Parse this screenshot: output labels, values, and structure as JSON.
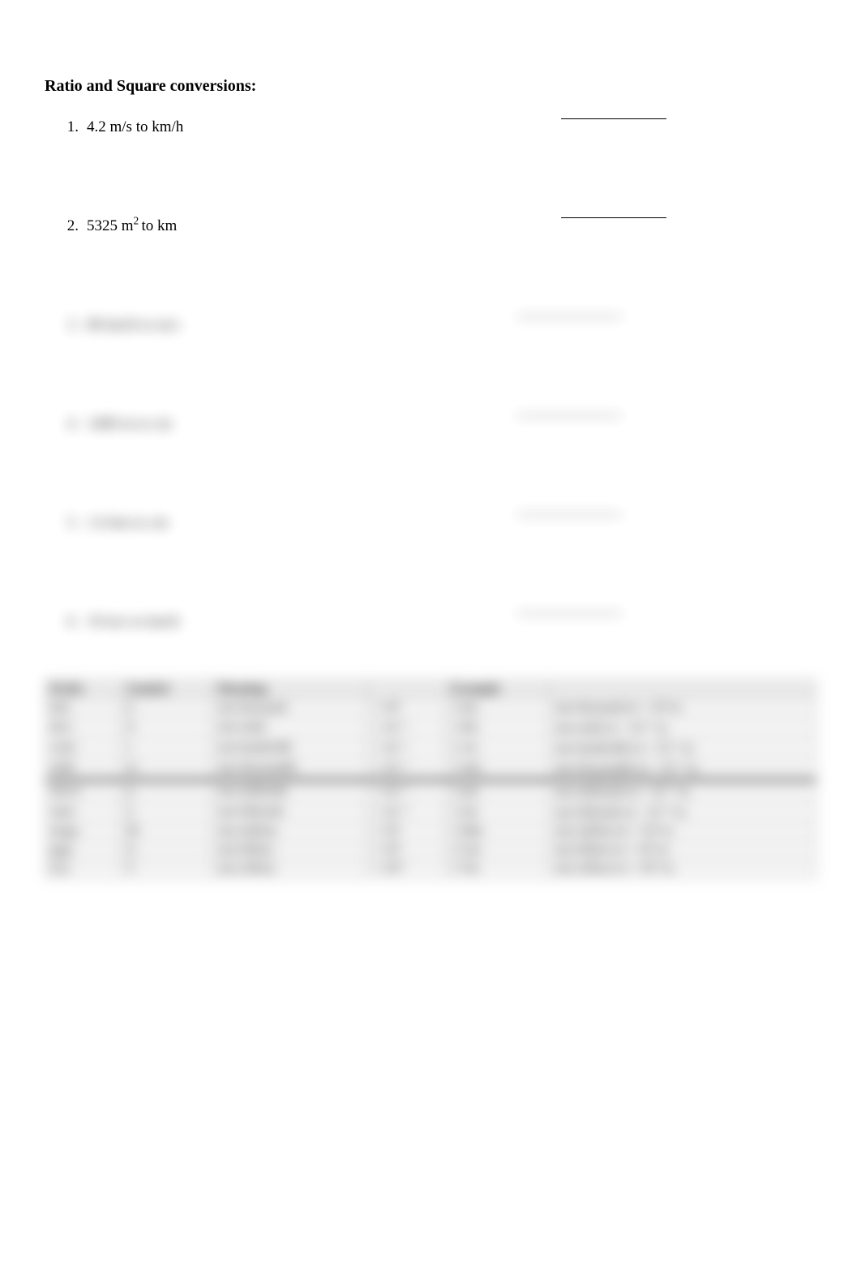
{
  "heading": "Ratio and Square conversions:",
  "questions": [
    {
      "num": "1.",
      "text_pre": "4.2 m/s to km/h",
      "sup": "",
      "text_post": "",
      "blurred": false
    },
    {
      "num": "2.",
      "text_pre": "5325 m",
      "sup": "2 ",
      "text_post": "to km",
      "blurred": false
    },
    {
      "num": "3.",
      "text_pre": "80 km/h to m/s",
      "sup": "",
      "text_post": "",
      "blurred": true
    },
    {
      "num": "4.",
      "text_pre": "1400 m to cm",
      "sup": "",
      "text_post": "",
      "blurred": true
    },
    {
      "num": "5.",
      "text_pre": "1.6 km to cm",
      "sup": "",
      "text_post": "",
      "blurred": true
    },
    {
      "num": "6.",
      "text_pre": "19 m/s to km/h",
      "sup": "",
      "text_post": "",
      "blurred": true
    }
  ],
  "table": {
    "headers": [
      "Prefix",
      "Symbol",
      "Meaning",
      "",
      "Example",
      ""
    ],
    "rows_top": [
      [
        "kilo",
        "k",
        "one thousand",
        "× 10³",
        "1 km",
        "one thousand m = 10³ m"
      ],
      [
        "deci",
        "d",
        "one tenth",
        "× 10⁻¹",
        "1 dm",
        "one tenth m = 10⁻¹ m"
      ],
      [
        "centi",
        "c",
        "one hundredth",
        "× 10⁻²",
        "1 cm",
        "one hundredth m = 10⁻² m"
      ],
      [
        "milli",
        "m",
        "one thousandth",
        "× 10⁻³",
        "1 mm",
        "one thousandth m = 10⁻³ m"
      ]
    ],
    "rows_bottom": [
      [
        "micro",
        "μ",
        "one millionth",
        "× 10⁻⁶",
        "1 μm",
        "one millionth m = 10⁻⁶ m"
      ],
      [
        "nano",
        "n",
        "one billionth",
        "× 10⁻⁹",
        "1 nm",
        "one billionth m = 10⁻⁹ m"
      ],
      [
        "mega",
        "M",
        "one million",
        "× 10⁶",
        "1 Mm",
        "one million m = 10⁶ m"
      ],
      [
        "giga",
        "G",
        "one billion",
        "× 10⁹",
        "1 Gm",
        "one billion m = 10⁹ m"
      ],
      [
        "tera",
        "T",
        "one trillion",
        "× 10¹²",
        "1 Tm",
        "one trillion m = 10¹² m"
      ]
    ]
  }
}
